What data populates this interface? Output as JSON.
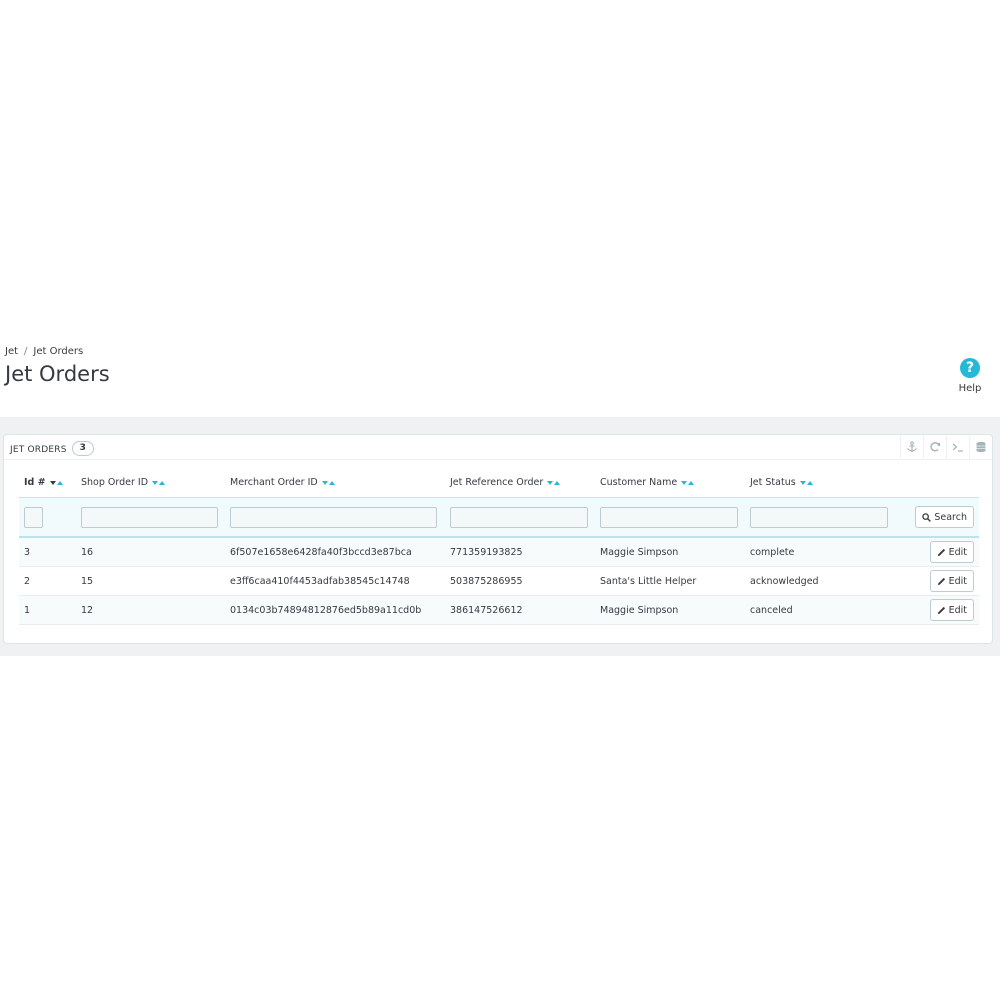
{
  "breadcrumb": {
    "parent": "Jet",
    "separator": "/",
    "current": "Jet Orders"
  },
  "page_title": "Jet Orders",
  "help": {
    "label": "Help",
    "glyph": "?"
  },
  "panel": {
    "title": "Jet Orders",
    "count": "3"
  },
  "toolbar_icons": [
    "anchor-icon",
    "refresh-icon",
    "terminal-icon",
    "database-icon"
  ],
  "table": {
    "columns": [
      "Id #",
      "Shop Order ID",
      "Merchant Order ID",
      "Jet Reference Order",
      "Customer Name",
      "Jet Status"
    ],
    "search_label": "Search",
    "edit_label": "Edit",
    "rows": [
      {
        "id": "3",
        "shop_order_id": "16",
        "merchant_order_id": "6f507e1658e6428fa40f3bccd3e87bca",
        "jet_reference_order": "771359193825",
        "customer_name": "Maggie Simpson",
        "jet_status": "complete"
      },
      {
        "id": "2",
        "shop_order_id": "15",
        "merchant_order_id": "e3ff6caa410f4453adfab38545c14748",
        "jet_reference_order": "503875286955",
        "customer_name": "Santa's Little Helper",
        "jet_status": "acknowledged"
      },
      {
        "id": "1",
        "shop_order_id": "12",
        "merchant_order_id": "0134c03b74894812876ed5b89a11cd0b",
        "jet_reference_order": "386147526612",
        "customer_name": "Maggie Simpson",
        "jet_status": "canceled"
      }
    ]
  },
  "colors": {
    "accent": "#25b9d7",
    "text": "#363a41",
    "border": "#bbcdd2",
    "background": "#eff1f2"
  }
}
